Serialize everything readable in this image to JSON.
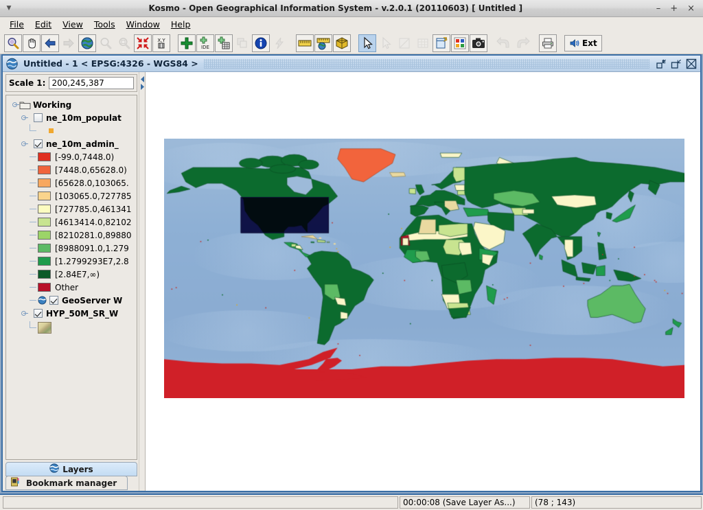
{
  "window": {
    "title": "Kosmo - Open Geographical Information System - v.2.0.1 (20110603)  [ Untitled ]",
    "minimize_label": "–",
    "maximize_label": "+",
    "close_label": "×",
    "menu_arrow": "▼"
  },
  "menubar": {
    "items": [
      {
        "label": "File"
      },
      {
        "label": "Edit"
      },
      {
        "label": "View"
      },
      {
        "label": "Tools"
      },
      {
        "label": "Window"
      },
      {
        "label": "Help"
      }
    ]
  },
  "toolbar": {
    "buttons": [
      {
        "name": "zoom-in-icon",
        "title": "Zoom in",
        "state": "framed"
      },
      {
        "name": "pan-hand-icon",
        "title": "Pan",
        "state": "framed"
      },
      {
        "name": "arrow-left-icon",
        "title": "Previous extent",
        "state": "framed"
      },
      {
        "name": "arrow-right-icon",
        "title": "Next extent",
        "state": "disabled"
      },
      {
        "name": "globe-full-extent-icon",
        "title": "Full extent",
        "state": "framed"
      },
      {
        "name": "zoom-layer-icon",
        "title": "Zoom to layer",
        "state": "disabled"
      },
      {
        "name": "zoom-selection-icon",
        "title": "Zoom to selection",
        "state": "disabled"
      },
      {
        "name": "zoom-arrows-icon",
        "title": "Zoom to extent",
        "state": "framed"
      },
      {
        "name": "xy-coordinates-icon",
        "title": "Go to X,Y",
        "state": "framed"
      },
      {
        "name": "add-layer-icon",
        "title": "Add layer",
        "state": "framed"
      },
      {
        "name": "add-ide-layer-icon",
        "title": "Add IDE layer",
        "state": "framed"
      },
      {
        "name": "add-table-layer-icon",
        "title": "Add table layer",
        "state": "framed"
      },
      {
        "name": "layer-properties-icon",
        "title": "Layer properties",
        "state": "disabled"
      },
      {
        "name": "info-icon",
        "title": "Information",
        "state": "framed"
      },
      {
        "name": "lightning-icon",
        "title": "Quick action",
        "state": "disabled"
      },
      {
        "name": "measure-ruler-icon",
        "title": "Measure",
        "state": "framed"
      },
      {
        "name": "measure-globe-icon",
        "title": "Measure on globe",
        "state": "framed"
      },
      {
        "name": "geoprocessing-box-icon",
        "title": "Geoprocessing",
        "state": "framed"
      },
      {
        "name": "select-pointer-icon",
        "title": "Select",
        "state": "sel"
      },
      {
        "name": "deselect-icon",
        "title": "Deselect",
        "state": "disabled"
      },
      {
        "name": "edit-geometry-icon",
        "title": "Edit geometry",
        "state": "disabled"
      },
      {
        "name": "attribute-table-icon",
        "title": "Attribute table",
        "state": "disabled"
      },
      {
        "name": "new-view-icon",
        "title": "New view",
        "state": "framed"
      },
      {
        "name": "symbology-icon",
        "title": "Symbology",
        "state": "framed"
      },
      {
        "name": "screenshot-camera-icon",
        "title": "Screen capture",
        "state": "framed"
      },
      {
        "name": "undo-icon",
        "title": "Undo",
        "state": "disabled"
      },
      {
        "name": "redo-icon",
        "title": "Redo",
        "state": "disabled"
      },
      {
        "name": "print-icon",
        "title": "Print",
        "state": "framed"
      }
    ],
    "ext_label": "Ext"
  },
  "mdi_frame": {
    "title": "Untitled - 1 < EPSG:4326 - WGS84 >",
    "restore_label": "Restore",
    "maximize_label": "Maximize",
    "close_label": "Close"
  },
  "scale": {
    "label": "Scale 1:",
    "value": "200,245,387",
    "placeholder": "Scale"
  },
  "tree": {
    "root": {
      "label": "Working",
      "icon": "folder-icon"
    },
    "layers": [
      {
        "label": "ne_10m_populat",
        "checked": false,
        "style_color": "#f0a830",
        "type": "point"
      },
      {
        "label": "ne_10m_admin_",
        "checked": true,
        "type": "classified",
        "classes": [
          {
            "label": "[-99.0,7448.0)",
            "color": "#e03020"
          },
          {
            "label": "[7448.0,65628.0)",
            "color": "#f0643c"
          },
          {
            "label": "[65628.0,103065.",
            "color": "#f8a860"
          },
          {
            "label": "[103065.0,727785",
            "color": "#fad48c"
          },
          {
            "label": "[727785.0,461341",
            "color": "#fcfcc0"
          },
          {
            "label": "[4613414.0,82102",
            "color": "#c8e490"
          },
          {
            "label": "[8210281.0,89880",
            "color": "#9cd468"
          },
          {
            "label": "[8988091.0,1.279",
            "color": "#5cba64"
          },
          {
            "label": "[1.2799293E7,2.8",
            "color": "#1f9c4c"
          },
          {
            "label": "[2.84E7,∞)",
            "color": "#0c5a28"
          },
          {
            "label": "Other",
            "color": "#b81028"
          }
        ]
      },
      {
        "label": "GeoServer W",
        "checked": true,
        "type": "wms"
      },
      {
        "label": "HYP_50M_SR_W",
        "checked": true,
        "type": "raster"
      }
    ]
  },
  "left_tabs": [
    {
      "label": "Layers",
      "icon": "globe-icon",
      "active": true
    },
    {
      "label": "Bookmark manager",
      "icon": "bookmark-icon",
      "active": false
    }
  ],
  "statusbar": {
    "message": "",
    "task": "00:00:08 (Save Layer As...)",
    "coordinates": "(78 ; 143)"
  },
  "map": {
    "ocean_color": "#8fb0d4",
    "selection_box_color": "#0d0d35",
    "land_default": "#0c6b2e",
    "antarctica_color": "#d02028",
    "greenland_color": "#f2643c"
  },
  "colors": {
    "accent": "#3a6ea5",
    "panel": "#ece9e4",
    "desktop": "#8ea7c4"
  }
}
